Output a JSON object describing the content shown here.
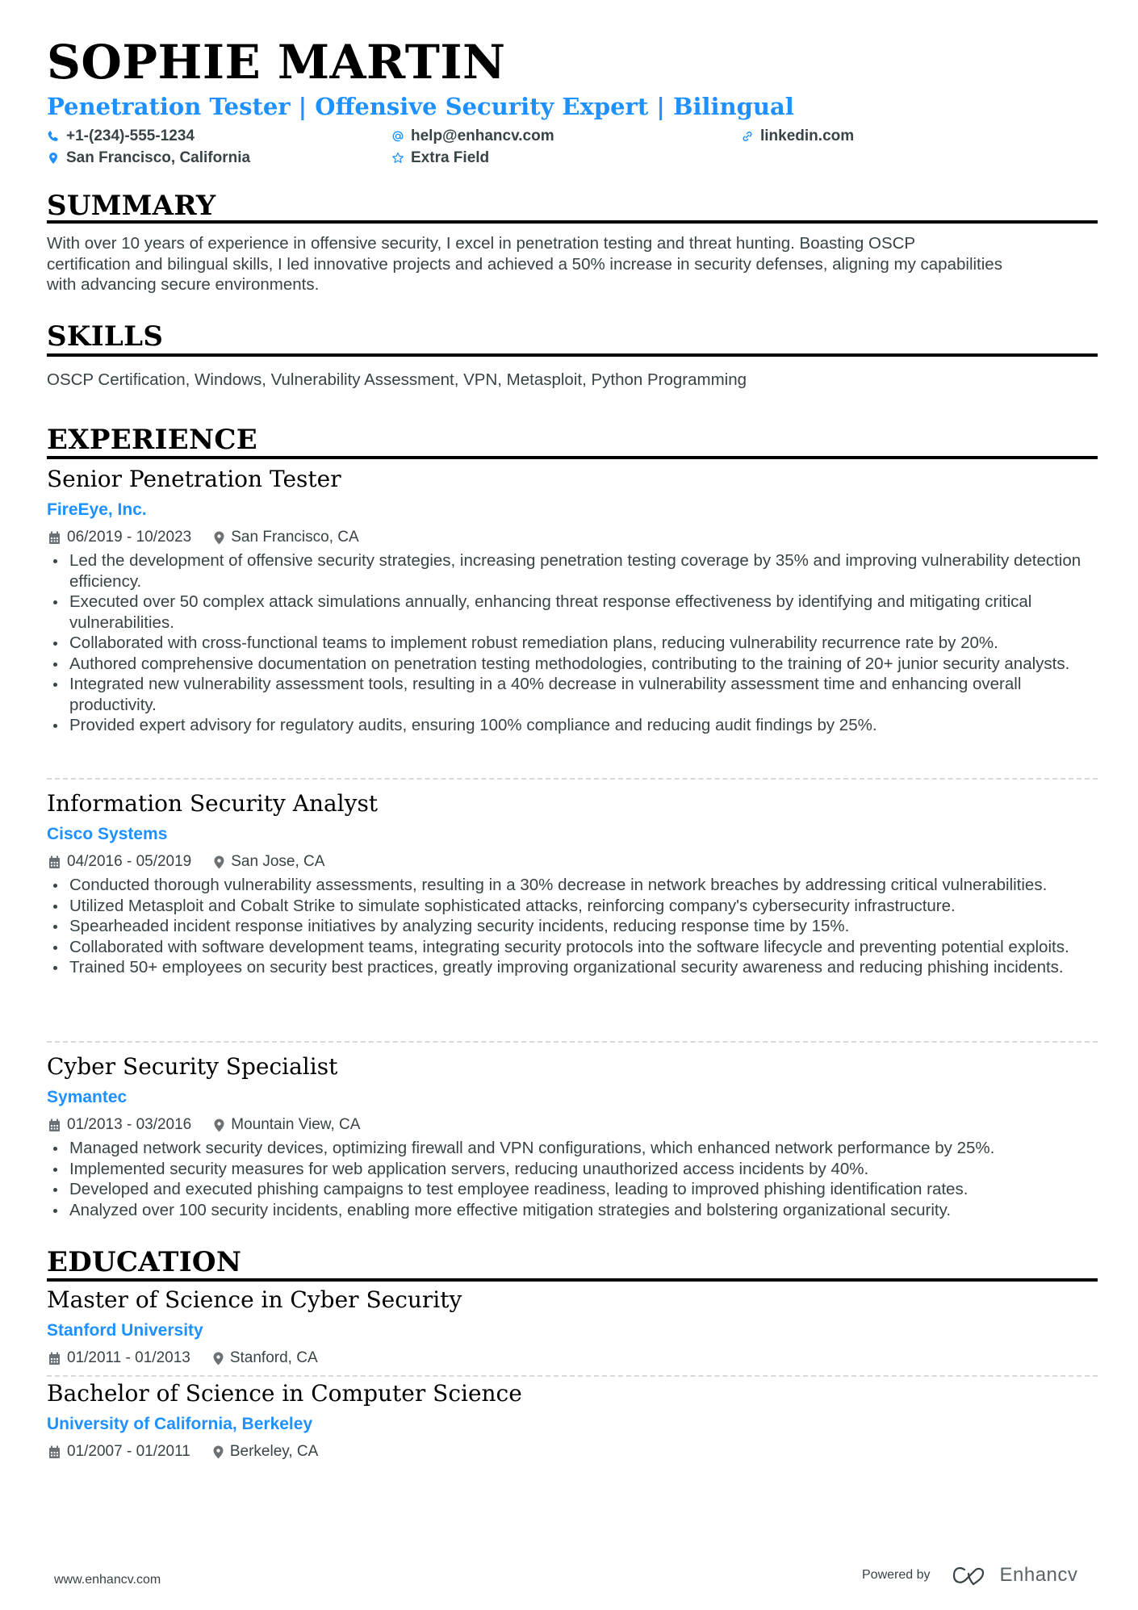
{
  "header": {
    "name": "SOPHIE MARTIN",
    "title": "Penetration Tester | Offensive Security Expert | Bilingual",
    "contacts": [
      {
        "icon": "phone-icon",
        "text": "+1-(234)-555-1234"
      },
      {
        "icon": "at-icon",
        "text": "help@enhancv.com"
      },
      {
        "icon": "link-icon",
        "text": "linkedin.com"
      },
      {
        "icon": "map-pin-icon",
        "text": "San Francisco, California"
      },
      {
        "icon": "star-icon",
        "text": "Extra Field"
      }
    ]
  },
  "colors": {
    "accent": "#1e90ff",
    "text": "#384347",
    "heading": "#000000"
  },
  "summary": {
    "heading": "SUMMARY",
    "lines": [
      "With over 10 years of experience in offensive security, I excel in penetration testing and threat hunting. Boasting OSCP",
      "certification and bilingual skills, I led innovative projects and achieved a 50% increase in security defenses, aligning my capabilities",
      "with advancing secure environments."
    ]
  },
  "skills": {
    "heading": "SKILLS",
    "text": "OSCP Certification, Windows, Vulnerability Assessment, VPN, Metasploit, Python Programming"
  },
  "experience": {
    "heading": "EXPERIENCE",
    "jobs": [
      {
        "title": "Senior Penetration Tester",
        "company": "FireEye, Inc.",
        "dates": "06/2019 - 10/2023",
        "location": "San Francisco, CA",
        "bullets": [
          "Led the development of offensive security strategies, increasing penetration testing coverage by 35% and improving vulnerability detection efficiency.",
          "Executed over 50 complex attack simulations annually, enhancing threat response effectiveness by identifying and mitigating critical vulnerabilities.",
          "Collaborated with cross-functional teams to implement robust remediation plans, reducing vulnerability recurrence rate by 20%.",
          "Authored comprehensive documentation on penetration testing methodologies, contributing to the training of 20+ junior security analysts.",
          "Integrated new vulnerability assessment tools, resulting in a 40% decrease in vulnerability assessment time and enhancing overall productivity.",
          "Provided expert advisory for regulatory audits, ensuring 100% compliance and reducing audit findings by 25%."
        ]
      },
      {
        "title": "Information Security Analyst",
        "company": "Cisco Systems",
        "dates": "04/2016 - 05/2019",
        "location": "San Jose, CA",
        "bullets": [
          "Conducted thorough vulnerability assessments, resulting in a 30% decrease in network breaches by addressing critical vulnerabilities.",
          "Utilized Metasploit and Cobalt Strike to simulate sophisticated attacks, reinforcing company's cybersecurity infrastructure.",
          "Spearheaded incident response initiatives by analyzing security incidents, reducing response time by 15%.",
          "Collaborated with software development teams, integrating security protocols into the software lifecycle and preventing potential exploits.",
          "Trained 50+ employees on security best practices, greatly improving organizational security awareness and reducing phishing incidents."
        ]
      },
      {
        "title": "Cyber Security Specialist",
        "company": "Symantec",
        "dates": "01/2013 - 03/2016",
        "location": "Mountain View, CA",
        "bullets": [
          "Managed network security devices, optimizing firewall and VPN configurations, which enhanced network performance by 25%.",
          "Implemented security measures for web application servers, reducing unauthorized access incidents by 40%.",
          "Developed and executed phishing campaigns to test employee readiness, leading to improved phishing identification rates.",
          "Analyzed over 100 security incidents, enabling more effective mitigation strategies and bolstering organizational security."
        ]
      }
    ]
  },
  "education": {
    "heading": "EDUCATION",
    "items": [
      {
        "degree": "Master of Science in Cyber Security",
        "school": "Stanford University",
        "dates": "01/2011 - 01/2013",
        "location": "Stanford, CA"
      },
      {
        "degree": "Bachelor of Science in Computer Science",
        "school": "University of California, Berkeley",
        "dates": "01/2007 - 01/2011",
        "location": "Berkeley, CA"
      }
    ]
  },
  "footer": {
    "website": "www.enhancv.com",
    "powered_by": "Powered by",
    "brand": "Enhancv"
  }
}
